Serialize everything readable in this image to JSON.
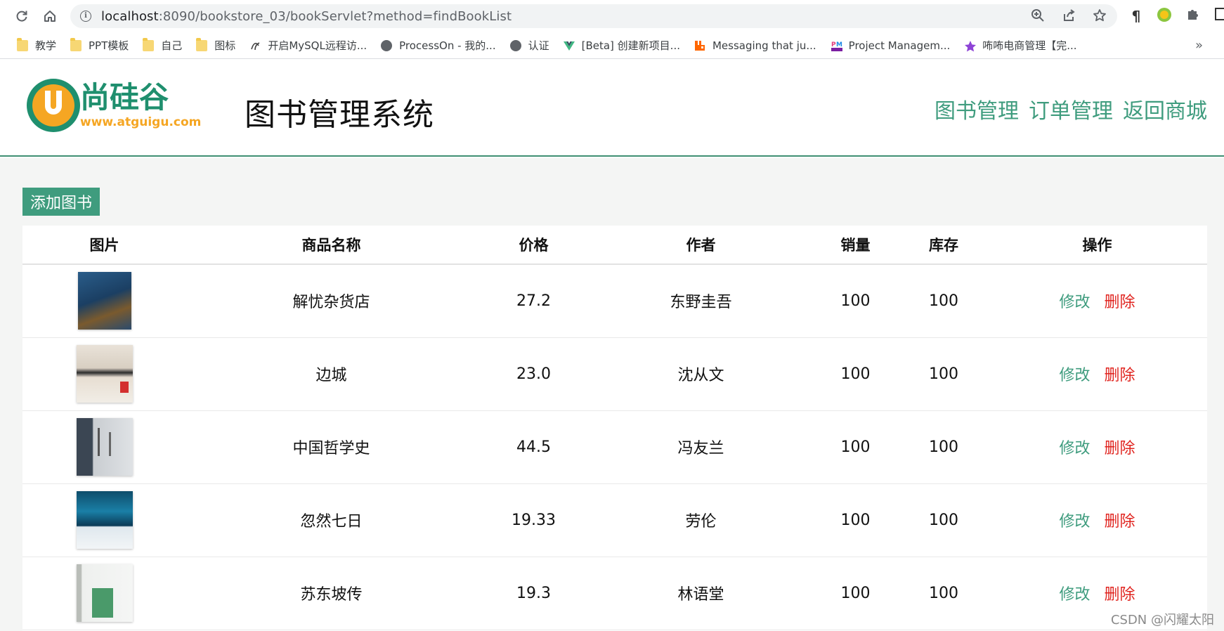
{
  "browser": {
    "url_host": "localhost",
    "url_path": ":8090/bookstore_03/bookServlet?method=findBookList",
    "bookmarks": [
      {
        "label": "教学",
        "icon": "folder-icon"
      },
      {
        "label": "PPT模板",
        "icon": "folder-icon"
      },
      {
        "label": "自己",
        "icon": "folder-icon"
      },
      {
        "label": "图标",
        "icon": "folder-icon"
      },
      {
        "label": "开启MySQL远程访...",
        "icon": "swirl-icon"
      },
      {
        "label": "ProcessOn - 我的...",
        "icon": "globe-icon"
      },
      {
        "label": "认证",
        "icon": "globe-icon"
      },
      {
        "label": "[Beta] 创建新项目...",
        "icon": "vue-icon"
      },
      {
        "label": "Messaging that ju...",
        "icon": "rabbitmq-icon"
      },
      {
        "label": "Project Managem...",
        "icon": "pm-icon"
      },
      {
        "label": "咘咘电商管理【完...",
        "icon": "star-icon"
      }
    ],
    "more": "»"
  },
  "header": {
    "logo_text": "尚硅谷",
    "logo_url": "www.atguigu.com",
    "title": "图书管理系统",
    "nav": [
      "图书管理",
      "订单管理",
      "返回商城"
    ]
  },
  "main": {
    "add_button": "添加图书",
    "columns": [
      "图片",
      "商品名称",
      "价格",
      "作者",
      "销量",
      "库存",
      "操作"
    ],
    "rows": [
      {
        "name": "解忧杂货店",
        "price": "27.2",
        "author": "东野圭吾",
        "sales": "100",
        "stock": "100",
        "edit": "修改",
        "delete": "删除"
      },
      {
        "name": "边城",
        "price": "23.0",
        "author": "沈从文",
        "sales": "100",
        "stock": "100",
        "edit": "修改",
        "delete": "删除"
      },
      {
        "name": "中国哲学史",
        "price": "44.5",
        "author": "冯友兰",
        "sales": "100",
        "stock": "100",
        "edit": "修改",
        "delete": "删除"
      },
      {
        "name": "忽然七日",
        "price": "19.33",
        "author": "劳伦",
        "sales": "100",
        "stock": "100",
        "edit": "修改",
        "delete": "删除"
      },
      {
        "name": "苏东坡传",
        "price": "19.3",
        "author": "林语堂",
        "sales": "100",
        "stock": "100",
        "edit": "修改",
        "delete": "删除"
      }
    ]
  },
  "watermark": "CSDN @闪耀太阳",
  "colors": {
    "accent": "#3f9c7e",
    "danger": "#e0241f",
    "background": "#f4f5f4"
  }
}
